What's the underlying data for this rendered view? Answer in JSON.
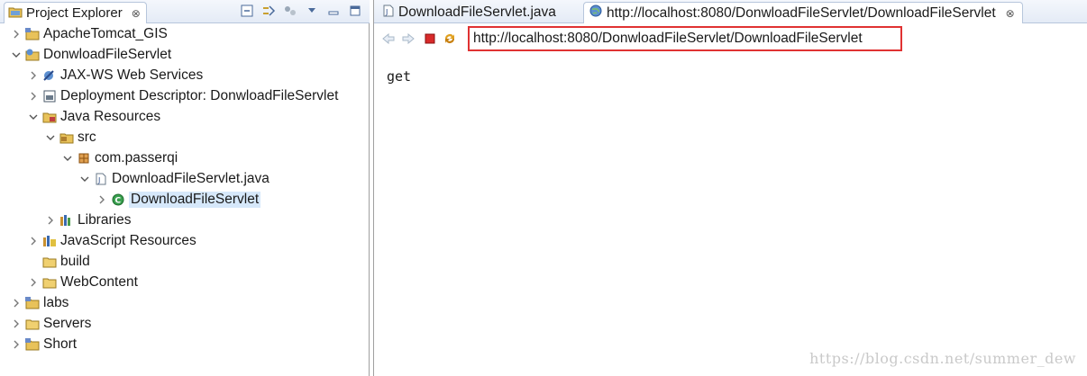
{
  "explorer": {
    "title": "Project Explorer",
    "close": "⊗",
    "tree": [
      {
        "label": "ApacheTomcat_GIS",
        "icon": "project-icon",
        "expanded": false,
        "selected": false
      },
      {
        "label": "DonwloadFileServlet",
        "icon": "web-project-icon",
        "expanded": true,
        "selected": false
      },
      {
        "label": "JAX-WS Web Services",
        "icon": "webservices-icon",
        "expanded": false,
        "selected": false
      },
      {
        "label": "Deployment Descriptor: DonwloadFileServlet",
        "icon": "descriptor-icon",
        "expanded": false,
        "selected": false
      },
      {
        "label": "Java Resources",
        "icon": "java-resources-icon",
        "expanded": true,
        "selected": false
      },
      {
        "label": "src",
        "icon": "source-folder-icon",
        "expanded": true,
        "selected": false
      },
      {
        "label": "com.passerqi",
        "icon": "package-icon",
        "expanded": true,
        "selected": false
      },
      {
        "label": "DownloadFileServlet.java",
        "icon": "java-file-icon",
        "expanded": true,
        "selected": false
      },
      {
        "label": "DownloadFileServlet",
        "icon": "class-icon",
        "expanded": false,
        "selected": true
      },
      {
        "label": "Libraries",
        "icon": "libraries-icon",
        "expanded": false,
        "selected": false
      },
      {
        "label": "JavaScript Resources",
        "icon": "js-resources-icon",
        "expanded": false,
        "selected": false
      },
      {
        "label": "build",
        "icon": "folder-icon",
        "expanded": null,
        "selected": false
      },
      {
        "label": "WebContent",
        "icon": "folder-icon",
        "expanded": false,
        "selected": false
      },
      {
        "label": "labs",
        "icon": "project-icon",
        "expanded": false,
        "selected": false
      },
      {
        "label": "Servers",
        "icon": "folder-icon",
        "expanded": false,
        "selected": false
      },
      {
        "label": "Short",
        "icon": "project-icon",
        "expanded": false,
        "selected": false
      }
    ]
  },
  "editor": {
    "tabs": [
      {
        "label": "DownloadFileServlet.java",
        "icon": "java-file-icon",
        "active": false
      },
      {
        "label": "http://localhost:8080/DonwloadFileServlet/DownloadFileServlet",
        "icon": "globe-icon",
        "active": true
      }
    ],
    "tab_close": "⊗",
    "url": "http://localhost:8080/DonwloadFileServlet/DownloadFileServlet",
    "page_content": "get"
  },
  "watermark": "https://blog.csdn.net/summer_dew",
  "colors": {
    "url_highlight": "#e03232",
    "selection": "#d6e8fa"
  }
}
